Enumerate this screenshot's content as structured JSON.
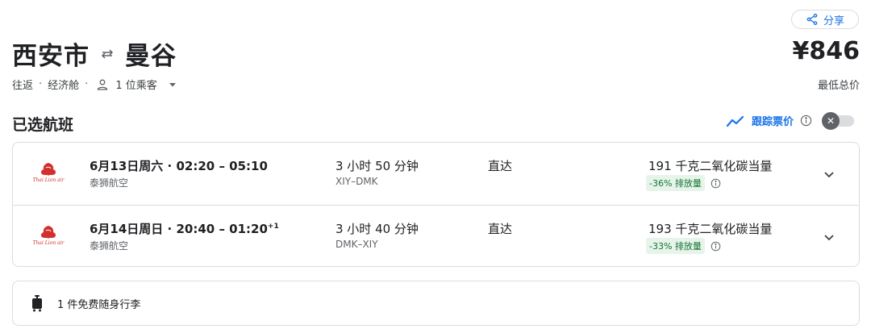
{
  "header": {
    "share_label": "分享",
    "origin": "西安市",
    "destination": "曼谷",
    "trip_type": "往返",
    "cabin": "经济舱",
    "passengers": "1 位乘客",
    "price": "¥846",
    "price_note": "最低总价"
  },
  "section": {
    "title": "已选航班",
    "track_label": "跟踪票价",
    "track_enabled": false
  },
  "flights": [
    {
      "logo_text": "Thai Lion air",
      "date": "6月13日周六",
      "depart": "02:20",
      "arrive": "05:10",
      "day_offset": "",
      "airline": "泰狮航空",
      "duration": "3 小时 50 分钟",
      "airports": "XIY–DMK",
      "stops": "直达",
      "emissions": "191 千克二氧化碳当量",
      "emissions_delta": "-36% 排放量"
    },
    {
      "logo_text": "Thai Lion air",
      "date": "6月14日周日",
      "depart": "20:40",
      "arrive": "01:20",
      "day_offset": "+1",
      "airline": "泰狮航空",
      "duration": "3 小时 40 分钟",
      "airports": "DMK–XIY",
      "stops": "直达",
      "emissions": "193 千克二氧化碳当量",
      "emissions_delta": "-33% 排放量"
    }
  ],
  "baggage": {
    "text": "1 件免费随身行李"
  },
  "colors": {
    "accent": "#1a73e8",
    "emission_bg": "#e6f4ea",
    "emission_fg": "#137333",
    "airline_brand": "#d32f2f"
  },
  "icons": [
    "share-icon",
    "swap-arrows-icon",
    "person-icon",
    "caret-down-icon",
    "trend-icon",
    "info-icon",
    "close-icon",
    "chevron-down-icon",
    "luggage-icon",
    "airline-logo"
  ]
}
